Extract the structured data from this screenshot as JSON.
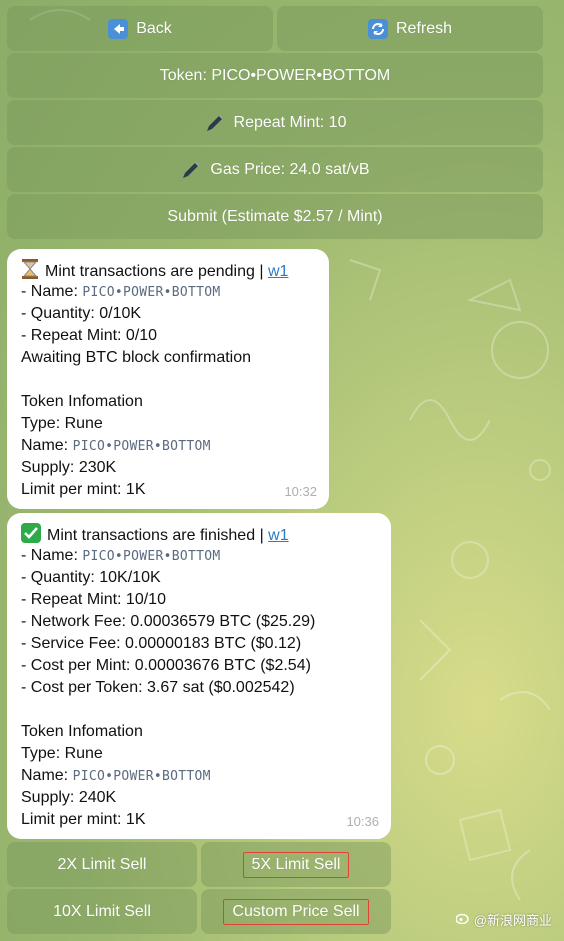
{
  "top_keyboard": {
    "back_label": "Back",
    "refresh_label": "Refresh",
    "token_label": "Token: PICO•POWER•BOTTOM",
    "repeat_mint_label": "Repeat Mint: 10",
    "gas_price_label": "Gas Price: 24.0 sat/vB",
    "submit_label": "Submit (Estimate $2.57 / Mint)"
  },
  "message_pending": {
    "title": "Mint transactions are pending",
    "separator": "|",
    "wallet_link": "w1",
    "name_label": "- Name: ",
    "name_value": "PICO•POWER•BOTTOM",
    "quantity": "- Quantity: 0/10K",
    "repeat_mint": "- Repeat Mint: 0/10",
    "status": "Awaiting BTC block confirmation",
    "info_header": "Token Infomation",
    "type": "Type: Rune",
    "info_name_label": "Name: ",
    "info_name_value": "PICO•POWER•BOTTOM",
    "supply": "Supply: 230K",
    "limit": "Limit per mint: 1K",
    "time": "10:32"
  },
  "message_finished": {
    "title": "Mint transactions are finished",
    "separator": "|",
    "wallet_link": "w1",
    "name_label": "- Name: ",
    "name_value": "PICO•POWER•BOTTOM",
    "quantity": "- Quantity: 10K/10K",
    "repeat_mint": "- Repeat Mint: 10/10",
    "network_fee": "- Network Fee: 0.00036579 BTC ($25.29)",
    "service_fee": "- Service Fee: 0.00000183 BTC ($0.12)",
    "cost_per_mint": "- Cost per Mint: 0.00003676 BTC ($2.54)",
    "cost_per_token": "- Cost per Token: 3.67 sat ($0.002542)",
    "info_header": "Token Infomation",
    "type": "Type: Rune",
    "info_name_label": "Name: ",
    "info_name_value": "PICO•POWER•BOTTOM",
    "supply": "Supply: 240K",
    "limit": "Limit per mint: 1K",
    "time": "10:36"
  },
  "bottom_keyboard": {
    "sell_2x": "2X Limit Sell",
    "sell_5x": "5X Limit Sell",
    "sell_10x": "10X Limit Sell",
    "sell_custom": "Custom Price Sell"
  },
  "watermark": {
    "text": "@新浪网商业"
  },
  "colors": {
    "link": "#2b7bc2",
    "timestamp": "#a9b0b6",
    "highlight_box": "#e0423a",
    "check_green": "#2eaa4a"
  }
}
